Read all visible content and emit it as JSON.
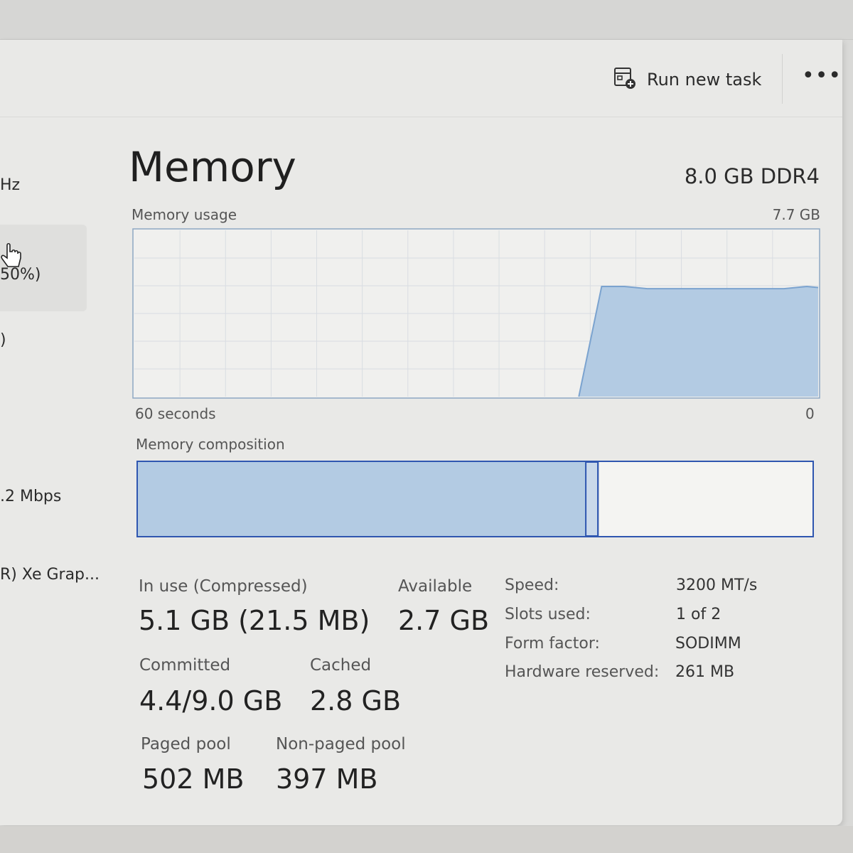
{
  "toolbar": {
    "run_new_task_label": "Run new task",
    "more_label": "•••"
  },
  "sidebar": {
    "fragment_hz": "Hz",
    "fragment_pct": "50%)",
    "fragment_paren": ")",
    "fragment_mbps": ".2 Mbps",
    "fragment_gpu": "R) Xe Grap..."
  },
  "memory": {
    "title": "Memory",
    "total": "8.0 GB DDR4",
    "usage_label": "Memory usage",
    "usage_max": "7.7 GB",
    "time_left": "60 seconds",
    "time_right": "0",
    "composition_label": "Memory composition"
  },
  "chart_data": {
    "type": "area",
    "title": "Memory usage",
    "xlabel": "",
    "ylabel": "",
    "x_range_seconds": [
      60,
      0
    ],
    "ylim": [
      0,
      7.7
    ],
    "y_unit": "GB",
    "grid": true,
    "color": "#b3cbe3",
    "stroke": "#7ba3cf",
    "x": [
      60,
      22,
      21,
      19,
      17,
      15,
      13,
      11,
      9,
      7,
      5,
      3,
      1,
      0
    ],
    "values": [
      null,
      null,
      0,
      5.1,
      5.1,
      5.0,
      5.0,
      5.0,
      5.0,
      5.0,
      5.0,
      5.0,
      5.1,
      5.05
    ]
  },
  "composition": {
    "in_use_fraction": 0.664,
    "modified_fraction": 0.018,
    "standby_fraction": 0.318,
    "in_use_color": "#b3cbe3",
    "border_color": "#2f56b0"
  },
  "stats": {
    "in_use_label": "In use (Compressed)",
    "in_use_value": "5.1 GB (21.5 MB)",
    "available_label": "Available",
    "available_value": "2.7 GB",
    "committed_label": "Committed",
    "committed_value": "4.4/9.0 GB",
    "cached_label": "Cached",
    "cached_value": "2.8 GB",
    "paged_label": "Paged pool",
    "paged_value": "502 MB",
    "nonpaged_label": "Non-paged pool",
    "nonpaged_value": "397 MB"
  },
  "specs": {
    "speed_label": "Speed:",
    "speed_value": "3200 MT/s",
    "slots_label": "Slots used:",
    "slots_value": "1 of 2",
    "form_label": "Form factor:",
    "form_value": "SODIMM",
    "hw_label": "Hardware reserved:",
    "hw_value": "261 MB"
  },
  "icons": {
    "run_task": "run-new-task-icon",
    "cursor": "hand-cursor-icon"
  }
}
